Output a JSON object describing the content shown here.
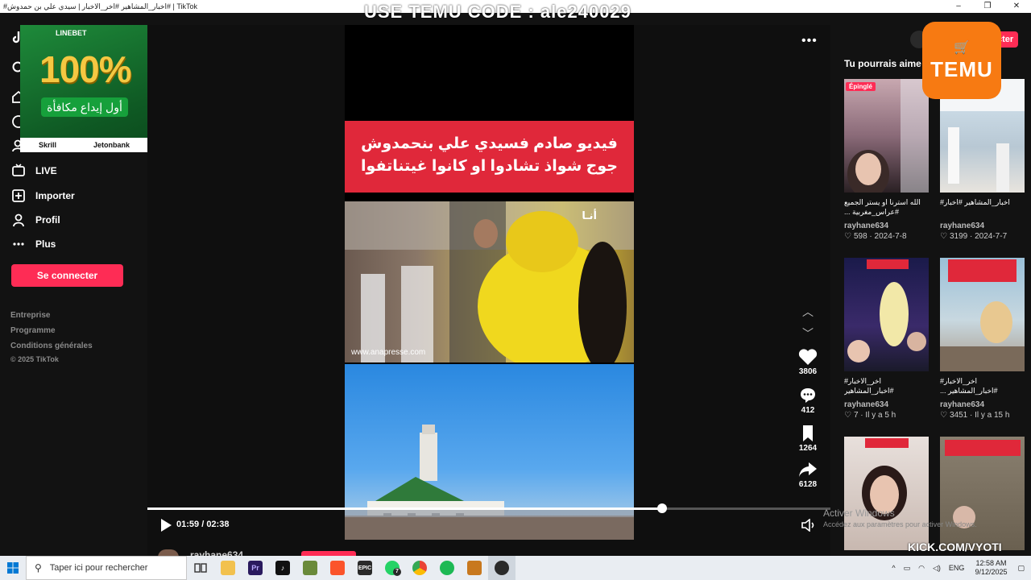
{
  "window": {
    "title": "#اخبار_المشاهير #اخر_الاخبار | سيدي علي بن حمدوش# | TikTok",
    "controls": [
      "–",
      "❐",
      "✕"
    ]
  },
  "overlay_top_text": "USE TEMU CODE : ale240029",
  "sidebar": {
    "items": [
      {
        "label": "LIVE",
        "icon": "live-icon"
      },
      {
        "label": "Importer",
        "icon": "upload-icon"
      },
      {
        "label": "Profil",
        "icon": "profile-icon"
      },
      {
        "label": "Plus",
        "icon": "more-icon"
      }
    ],
    "connect_label": "Se connecter",
    "footer": [
      "Entreprise",
      "Programme",
      "Conditions générales"
    ],
    "copyright": "© 2025 TikTok"
  },
  "ad": {
    "brand": "LINEBET",
    "headline": "100%",
    "arabic_line": "أول إيداع مكافأة",
    "payment": [
      "Skrill",
      "Jetonbank"
    ]
  },
  "video": {
    "caption_line1": "فيديو صادم فسيدي علي بنحمدوش",
    "caption_line2": "جوج شواذ تشادوا او كانوا غيتناتفوا",
    "watermark": "www.anapresse.com",
    "channel_logo": "أنـا",
    "time_current": "01:59",
    "time_total": "02:38",
    "progress": 0.754
  },
  "actions": {
    "likes": "3806",
    "comments": "412",
    "saves": "1264",
    "shares": "6128"
  },
  "author": {
    "name": "rayhane634"
  },
  "recommended": {
    "heading": "Tu pourrais aime",
    "pinned_label": "Épinglé",
    "items": [
      {
        "title": "الله استرنا او يستر الجميع #عراس_مغربية ...",
        "author": "rayhane634",
        "meta": "598 · 2024-7-8"
      },
      {
        "title": "اخبار_المشاهير #اخبار#",
        "author": "rayhane634",
        "meta": "3199 · 2024-7-7"
      },
      {
        "title": "اخر_الاخبار# #اخبار_المشاهير",
        "author": "rayhane634",
        "meta": "7 · Il y a 5 h"
      },
      {
        "title": "اخر_الاخبار# #اخبار_المشاهير ...",
        "author": "rayhane634",
        "meta": "3451 · Il y a 15 h"
      }
    ]
  },
  "promo_badge": "TEMU",
  "windows_watermark": {
    "line1": "Activer Windows",
    "line2": "Accédez aux paramètres pour activer Windows."
  },
  "streamer_tag": "KICK.COM/VYOTI",
  "taskbar": {
    "search_placeholder": "Taper ici pour rechercher",
    "lang": "ENG",
    "time": "12:58 AM",
    "date": "9/12/2025",
    "whatsapp_badge": "7"
  }
}
